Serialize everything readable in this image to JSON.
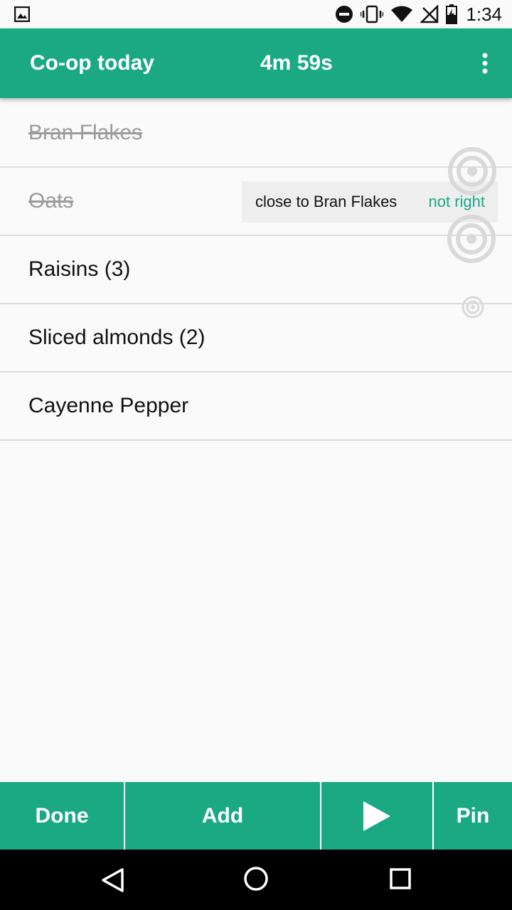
{
  "status_bar": {
    "time": "1:34",
    "icons": [
      "gallery-icon",
      "do-not-disturb-icon",
      "vibrate-icon",
      "wifi-icon",
      "no-signal-icon",
      "battery-charging-icon"
    ]
  },
  "app_bar": {
    "title": "Co-op today",
    "timer": "4m 59s",
    "menu_icon": "more-vert-icon"
  },
  "items": [
    {
      "label": "Bran Flakes",
      "checked": true
    },
    {
      "label": "Oats",
      "checked": true,
      "suggestion": {
        "text": "close to Bran Flakes",
        "action": "not right"
      }
    },
    {
      "label": "Raisins (3)",
      "checked": false,
      "icon": "target-icon"
    },
    {
      "label": "Sliced almonds (2)",
      "checked": false,
      "icon": "target-icon"
    },
    {
      "label": "Cayenne Pepper",
      "checked": false,
      "icon": "target-small-icon"
    }
  ],
  "bottom_bar": {
    "done": "Done",
    "add": "Add",
    "play_icon": "play-icon",
    "pin": "Pin"
  },
  "nav_bar": [
    "back-icon",
    "home-icon",
    "recents-icon"
  ],
  "colors": {
    "accent": "#1aa983",
    "checked_text": "#9b9b9b",
    "divider": "#dddddd"
  }
}
